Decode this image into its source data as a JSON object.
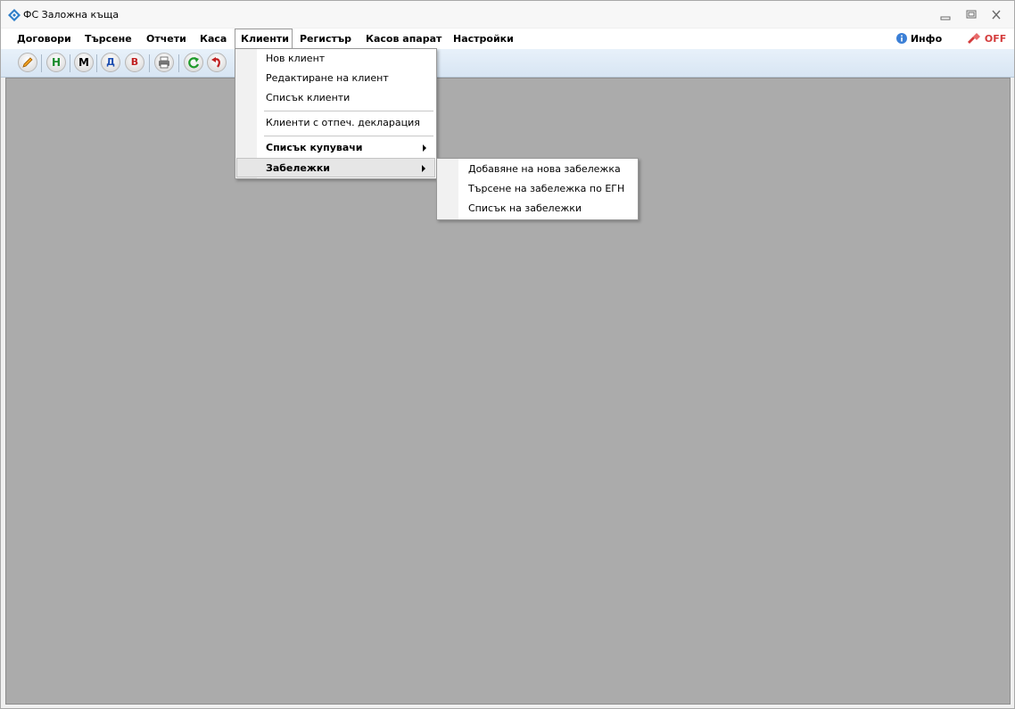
{
  "window": {
    "title": "ФС Заложна къща"
  },
  "menubar": {
    "items": [
      "Договори",
      "Търсене",
      "Отчети",
      "Каса",
      "Клиенти",
      "Регистър",
      "Касов апарат",
      "Настройки"
    ],
    "info_label": "Инфо",
    "off_label": "OFF"
  },
  "toolbar": {
    "letters": {
      "new": "Н",
      "m": "М",
      "d": "Д",
      "v": "В"
    }
  },
  "clients_menu": {
    "items": [
      "Нов клиент",
      "Редактиране на клиент",
      "Списък клиенти",
      "Клиенти с отпеч. декларация",
      "Списък купувачи",
      "Забележки"
    ]
  },
  "notes_submenu": {
    "items": [
      "Добавяне на нова забележка",
      "Търсене на забележка по ЕГН",
      "Списък на забележки"
    ]
  },
  "colors": {
    "workarea": "#ababab",
    "toolbar": "#dde9f5",
    "off_red": "#d43c3c",
    "info_blue": "#3b7fd6"
  }
}
